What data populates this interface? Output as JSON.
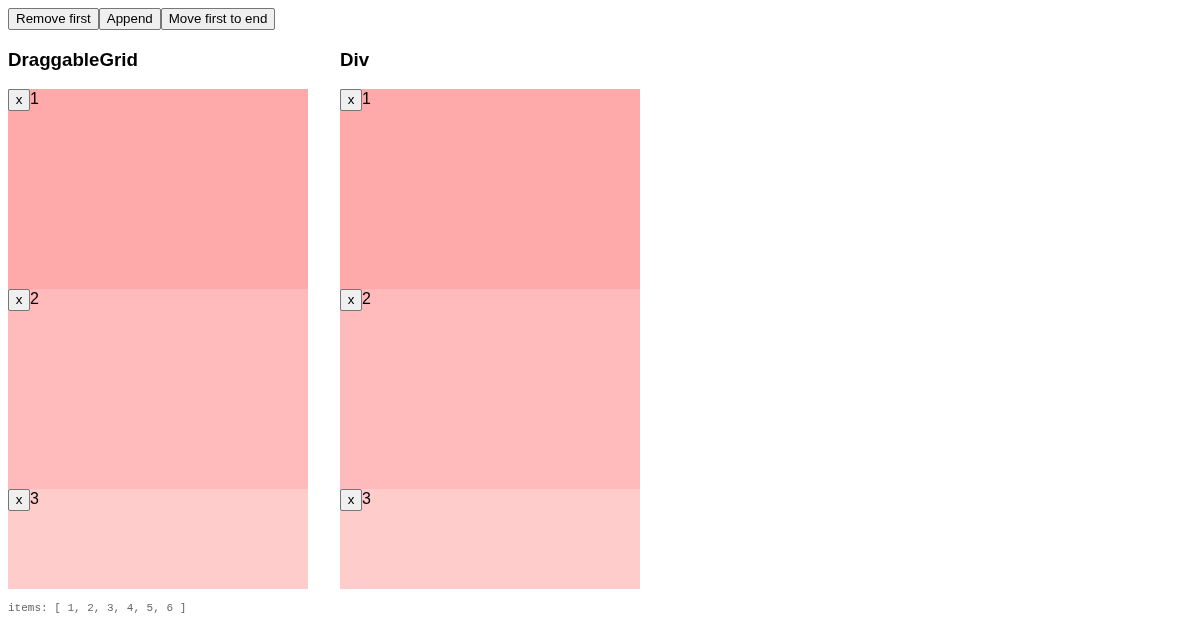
{
  "toolbar": {
    "buttons": [
      "Remove first",
      "Append",
      "Move first to end"
    ]
  },
  "panels": [
    {
      "title": "DraggableGrid",
      "items": [
        {
          "remove": "x",
          "label": "1",
          "color": "#ffaaaa"
        },
        {
          "remove": "x",
          "label": "2",
          "color": "#ffbbbb"
        },
        {
          "remove": "x",
          "label": "3",
          "color": "#ffcccc"
        }
      ]
    },
    {
      "title": "Div",
      "items": [
        {
          "remove": "x",
          "label": "1",
          "color": "#ffaaaa"
        },
        {
          "remove": "x",
          "label": "2",
          "color": "#ffbbbb"
        },
        {
          "remove": "x",
          "label": "3",
          "color": "#ffcccc"
        }
      ]
    }
  ],
  "footer": "items: [ 1, 2, 3, 4, 5, 6 ]"
}
